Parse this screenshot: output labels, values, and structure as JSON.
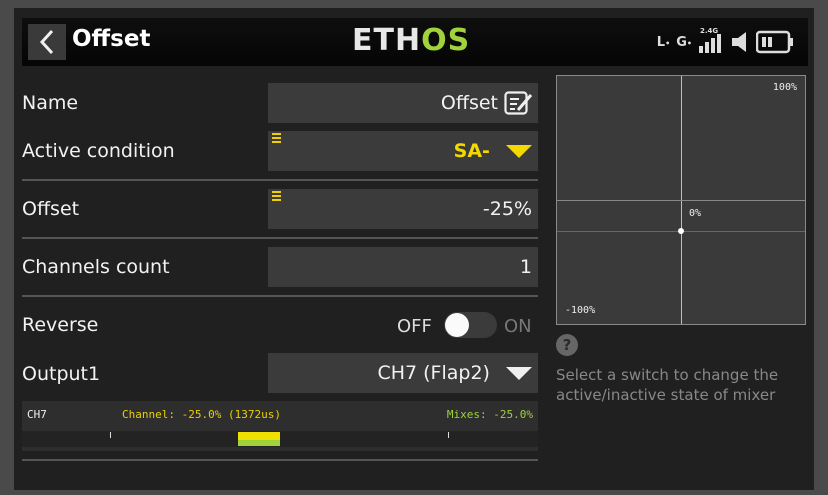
{
  "header": {
    "title": "Offset",
    "logo_main": "ETH",
    "logo_accent": "OS",
    "status": {
      "l_tag": "L",
      "g_tag": "G",
      "band": "2.4G"
    }
  },
  "rows": {
    "name": {
      "label": "Name",
      "value": "Offset"
    },
    "active_condition": {
      "label": "Active condition",
      "value": "SA-"
    },
    "offset": {
      "label": "Offset",
      "value": "-25%"
    },
    "channels_count": {
      "label": "Channels count",
      "value": "1"
    },
    "reverse": {
      "label": "Reverse",
      "off_label": "OFF",
      "on_label": "ON",
      "state": false
    },
    "output1": {
      "label": "Output1",
      "value": "CH7 (Flap2)"
    }
  },
  "channel_monitor": {
    "channel": "CH7",
    "channel_info": "Channel: -25.0% (1372us)",
    "mixes_info": "Mixes: -25.0%",
    "channel_color": "#e8d000",
    "mixes_color": "#9fd23b",
    "channel_value_percent": -25.0,
    "mixes_value_percent": -25.0
  },
  "graph": {
    "top_label": "100%",
    "mid_label": "0%",
    "bottom_label": "-100%",
    "vertical_line_color": "#e8d000",
    "horizontal_line_color": "#d83a2a"
  },
  "help": {
    "icon": "?",
    "text": "Select a switch to change the active/inactive state of mixer"
  },
  "colors": {
    "accent_yellow": "#f4d900",
    "accent_green": "#9fd23b",
    "field_bg": "#3b3b3b",
    "page_bg": "#202020"
  }
}
